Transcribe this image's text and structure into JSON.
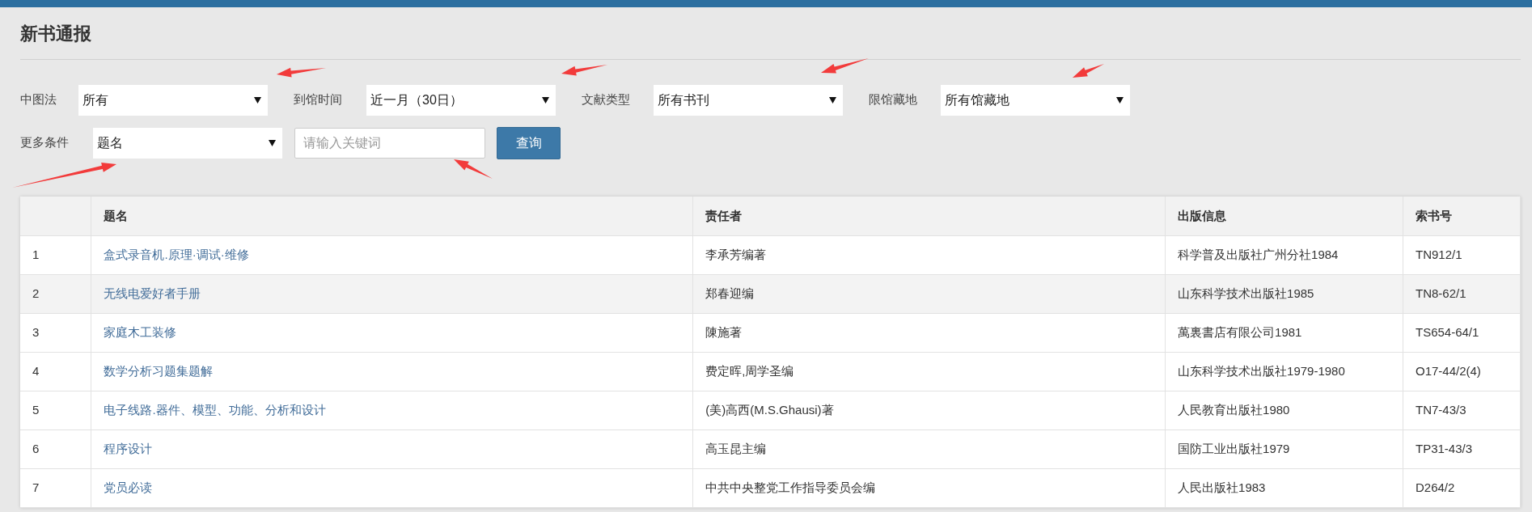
{
  "page_title": "新书通报",
  "filters": [
    {
      "label": "中图法",
      "value": "所有"
    },
    {
      "label": "到馆时间",
      "value": "近一月（30日）"
    },
    {
      "label": "文献类型",
      "value": "所有书刊"
    },
    {
      "label": "限馆藏地",
      "value": "所有馆藏地"
    }
  ],
  "more_conditions": {
    "label": "更多条件",
    "field": "题名",
    "keyword": {
      "placeholder": "请输入关键词"
    },
    "search_button": "查询"
  },
  "table": {
    "columns": [
      "题名",
      "责任者",
      "出版信息",
      "索书号"
    ],
    "rows": [
      {
        "index": "1",
        "title": "盒式录音机.原理·调试·维修",
        "author": "李承芳编著",
        "publisher": "科学普及出版社广州分社1984",
        "call_number": "TN912/1",
        "hovered": false
      },
      {
        "index": "2",
        "title": "无线电爱好者手册",
        "author": "郑春迎编",
        "publisher": "山东科学技术出版社1985",
        "call_number": "TN8-62/1",
        "hovered": true
      },
      {
        "index": "3",
        "title": "家庭木工装修",
        "author": "陳施著",
        "publisher": "萬裏書店有限公司1981",
        "call_number": "TS654-64/1",
        "hovered": false
      },
      {
        "index": "4",
        "title": "数学分析习题集题解",
        "author": "费定晖,周学圣编",
        "publisher": "山东科学技术出版社1979-1980",
        "call_number": "O17-44/2(4)",
        "hovered": false
      },
      {
        "index": "5",
        "title": "电子线路.器件、模型、功能、分析和设计",
        "author": "(美)高西(M.S.Ghausi)著",
        "publisher": "人民教育出版社1980",
        "call_number": "TN7-43/3",
        "hovered": false
      },
      {
        "index": "6",
        "title": "程序设计",
        "author": "高玉昆主编",
        "publisher": "国防工业出版社1979",
        "call_number": "TP31-43/3",
        "hovered": false
      },
      {
        "index": "7",
        "title": "党员必读",
        "author": "中共中央整党工作指导委员会编",
        "publisher": "人民出版社1983",
        "call_number": "D264/2",
        "hovered": false
      }
    ]
  }
}
